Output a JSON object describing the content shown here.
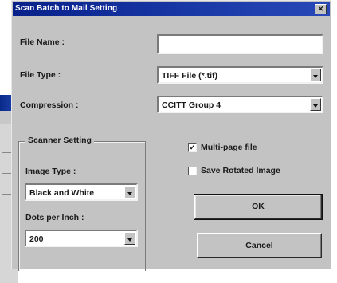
{
  "dialog": {
    "title": "Scan Batch to Mail Setting",
    "close_glyph": "✕"
  },
  "fields": {
    "file_name": {
      "label": "File Name :",
      "accel": "N",
      "value": ""
    },
    "file_type": {
      "label": "File Type :",
      "accel": "T",
      "value": "TIFF File (*.tif)"
    },
    "compression": {
      "label": "Compression :",
      "accel": "C",
      "value": "CCITT Group 4"
    }
  },
  "scanner": {
    "group_title": "Scanner Setting",
    "image_type": {
      "label": "Image Type :",
      "value": "Black and White"
    },
    "dots_per_inch": {
      "label": "Dots per Inch :",
      "accel": "D",
      "value": "200"
    }
  },
  "options": {
    "multipage": {
      "label": "Multi-page file",
      "accel": "M",
      "checked": true
    },
    "save_rotated": {
      "label": "Save Rotated Image",
      "checked": false
    }
  },
  "buttons": {
    "ok": "OK",
    "cancel": "Cancel"
  },
  "colors": {
    "title_bar": "#08218a",
    "dialog_face": "#c3c3c3"
  }
}
